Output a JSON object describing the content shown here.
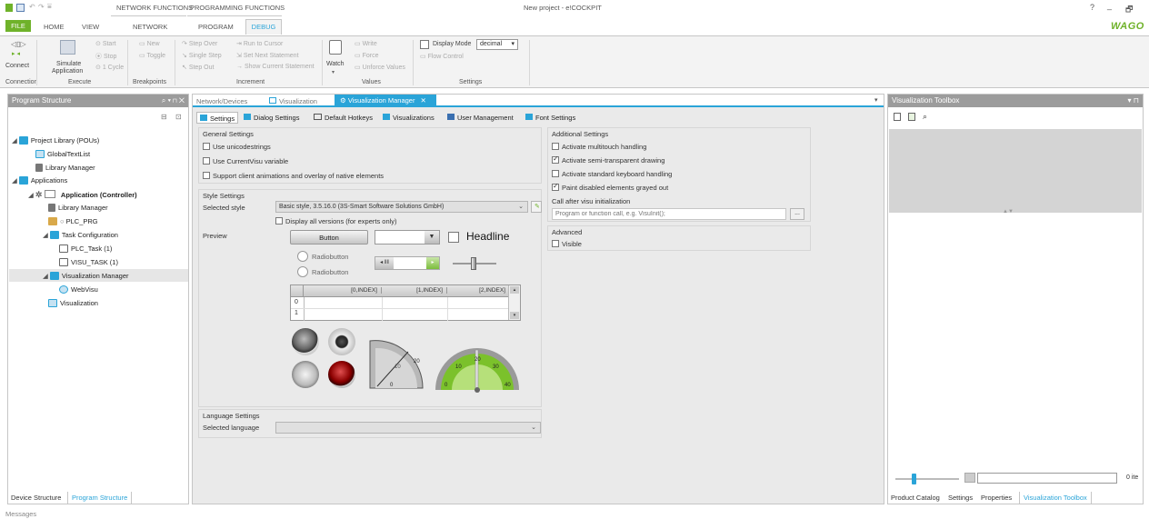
{
  "window": {
    "title": "New project - e!COCKPIT",
    "help": "?",
    "minimize": "_",
    "restore": "🗗",
    "logo": "WAGO"
  },
  "context_tabs": [
    "NETWORK FUNCTIONS",
    "PROGRAMMING FUNCTIONS"
  ],
  "ribbon_tabs": [
    "FILE",
    "HOME",
    "VIEW",
    "NETWORK",
    "PROGRAM",
    "DEBUG"
  ],
  "ribbon": {
    "connection": {
      "connect": "Connect",
      "label": "Connection"
    },
    "execute": {
      "simulate_1": "Simulate",
      "simulate_2": "Application",
      "start": "Start",
      "stop": "Stop",
      "cycle": "1 Cycle",
      "label": "Execute"
    },
    "breakpoints": {
      "new": "New",
      "toggle": "Toggle",
      "label": "Breakpoints"
    },
    "increment": {
      "step_over": "Step Over",
      "single_step": "Single Step",
      "step_out": "Step Out",
      "run_to_cursor": "Run to Cursor",
      "set_next": "Set Next Statement",
      "show_current": "Show Current Statement",
      "label": "Increment"
    },
    "values": {
      "watch": "Watch",
      "write": "Write",
      "force": "Force",
      "unforce": "Unforce Values",
      "label": "Values"
    },
    "settings": {
      "display_mode": "Display Mode",
      "display_value": "decimal",
      "flow_control": "Flow Control",
      "label": "Settings"
    }
  },
  "left_panel": {
    "title": "Program Structure",
    "controls": "⌕ ▾ ⊓ ✕",
    "tree": [
      "Project Library (POUs)",
      "GlobalTextList",
      "Library Manager",
      "Applications",
      "Application (Controller)",
      "Library Manager",
      "PLC_PRG",
      "Task Configuration",
      "PLC_Task (1)",
      "VISU_TASK (1)",
      "Visualization Manager",
      "WebVisu",
      "Visualization"
    ],
    "bottom_tabs": [
      "Device Structure",
      "Program Structure"
    ]
  },
  "doc_tabs": [
    "Network/Devices",
    "Visualization",
    "Visualization Manager"
  ],
  "sub_tabs": [
    "Settings",
    "Dialog Settings",
    "Default Hotkeys",
    "Visualizations",
    "User Management",
    "Font Settings"
  ],
  "general": {
    "title": "General Settings",
    "items": [
      {
        "label": "Use unicodestrings",
        "checked": false
      },
      {
        "label": "Use CurrentVisu variable",
        "checked": false
      },
      {
        "label": "Support client animations and overlay of native elements",
        "checked": false
      }
    ]
  },
  "style": {
    "title": "Style Settings",
    "selected_label": "Selected style",
    "selected_value": "Basic style, 3.5.16.0 (3S-Smart Software Solutions GmbH)",
    "all_versions": "Display all versions (for experts only)"
  },
  "preview": {
    "label": "Preview",
    "button": "Button",
    "headline": "Headline",
    "radio1": "Radiobutton",
    "radio2": "Radiobutton",
    "table_cols": [
      "[0,INDEX]",
      "[1,INDEX]",
      "[2,INDEX]"
    ],
    "table_rows": [
      "0",
      "1"
    ],
    "gauge1": [
      "0",
      "20",
      "10"
    ],
    "gauge2": [
      "0",
      "10",
      "20",
      "30",
      "40"
    ]
  },
  "language": {
    "title": "Language Settings",
    "selected_label": "Selected language"
  },
  "additional": {
    "title": "Additional Settings",
    "items": [
      {
        "label": "Activate multitouch handling",
        "checked": false
      },
      {
        "label": "Activate semi-transparent drawing",
        "checked": true
      },
      {
        "label": "Activate standard keyboard handling",
        "checked": false
      },
      {
        "label": "Paint disabled elements grayed out",
        "checked": true
      }
    ],
    "call_after_label": "Call after visu initialization",
    "call_after_placeholder": "Program or function call, e.g. VisuInit();",
    "call_btn": "..."
  },
  "advanced": {
    "title": "Advanced",
    "visible": "Visible"
  },
  "right_panel": {
    "title": "Visualization Toolbox",
    "count": "0 ite",
    "bottom_tabs": [
      "Product Catalog",
      "Settings",
      "Properties",
      "Visualization Toolbox"
    ]
  },
  "status": {
    "messages": "Messages"
  },
  "colors": {
    "accent": "#2aa4d8",
    "ribbon_bg": "#f3f3f3",
    "panel_header": "#9c9c9c",
    "wago_green": "#6fb22a"
  }
}
